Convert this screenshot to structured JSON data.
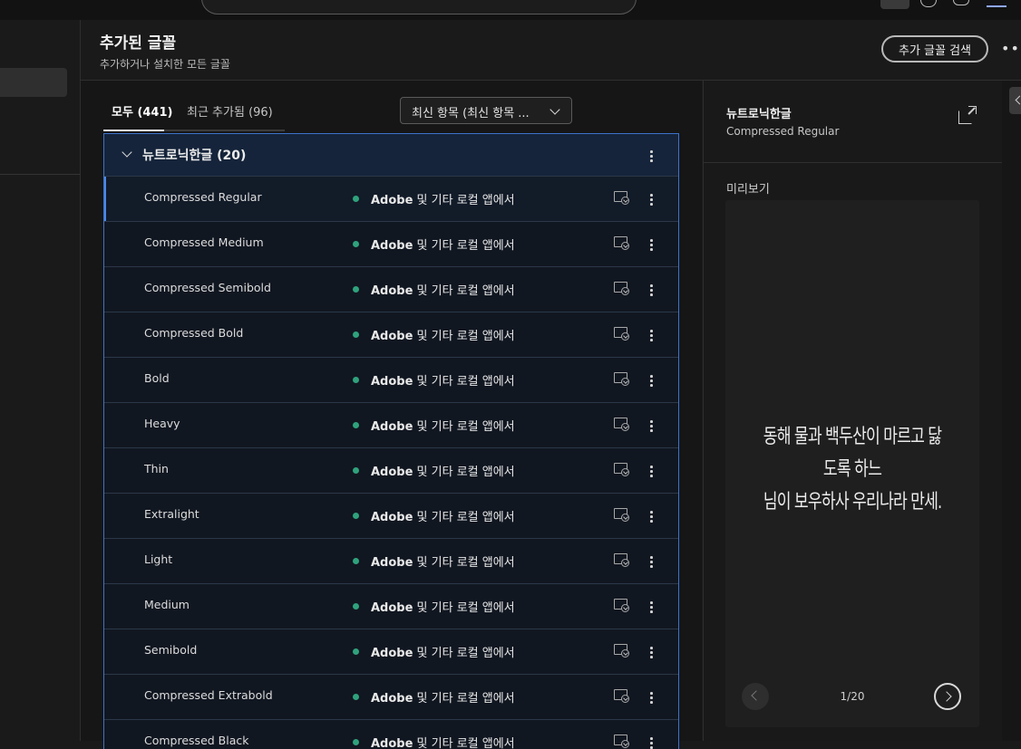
{
  "header": {
    "title": "추가된 글꼴",
    "subtitle": "추가하거나 설치한 모든 글꼴",
    "browse_button": "추가 글꼴 검색"
  },
  "tabs": [
    {
      "label": "모두 (441)",
      "active": true
    },
    {
      "label": "최근 추가됨 (96)",
      "active": false
    }
  ],
  "sort": {
    "label": "최신 항목 (최신 항목 ..."
  },
  "family": {
    "name": "뉴트로닉한글 (20)",
    "rows": [
      {
        "style": "Compressed Regular",
        "status_app": "Adobe",
        "status_rest": " 및 기타 로컬 앱에서"
      },
      {
        "style": "Compressed Medium",
        "status_app": "Adobe",
        "status_rest": " 및 기타 로컬 앱에서"
      },
      {
        "style": "Compressed Semibold",
        "status_app": "Adobe",
        "status_rest": " 및 기타 로컬 앱에서"
      },
      {
        "style": "Compressed Bold",
        "status_app": "Adobe",
        "status_rest": " 및 기타 로컬 앱에서"
      },
      {
        "style": "Bold",
        "status_app": "Adobe",
        "status_rest": " 및 기타 로컬 앱에서"
      },
      {
        "style": "Heavy",
        "status_app": "Adobe",
        "status_rest": " 및 기타 로컬 앱에서"
      },
      {
        "style": "Thin",
        "status_app": "Adobe",
        "status_rest": " 및 기타 로컬 앱에서"
      },
      {
        "style": "Extralight",
        "status_app": "Adobe",
        "status_rest": " 및 기타 로컬 앱에서"
      },
      {
        "style": "Light",
        "status_app": "Adobe",
        "status_rest": " 및 기타 로컬 앱에서"
      },
      {
        "style": "Medium",
        "status_app": "Adobe",
        "status_rest": " 및 기타 로컬 앱에서"
      },
      {
        "style": "Semibold",
        "status_app": "Adobe",
        "status_rest": " 및 기타 로컬 앱에서"
      },
      {
        "style": "Compressed Extrabold",
        "status_app": "Adobe",
        "status_rest": " 및 기타 로컬 앱에서"
      },
      {
        "style": "Compressed Black",
        "status_app": "Adobe",
        "status_rest": " 및 기타 로컬 앱에서"
      }
    ]
  },
  "detail": {
    "family": "뉴트로닉한글",
    "style": "Compressed Regular",
    "preview_label": "미리보기",
    "preview_line1": "동해 물과 백두산이 마르고 닳도록 하느",
    "preview_line2": "님이 보우하사 우리나라 만세.",
    "page_counter": "1/20"
  },
  "colors": {
    "accent": "#3d73c9",
    "status_dot": "#2fa27c",
    "background": "#1a1a1a"
  }
}
